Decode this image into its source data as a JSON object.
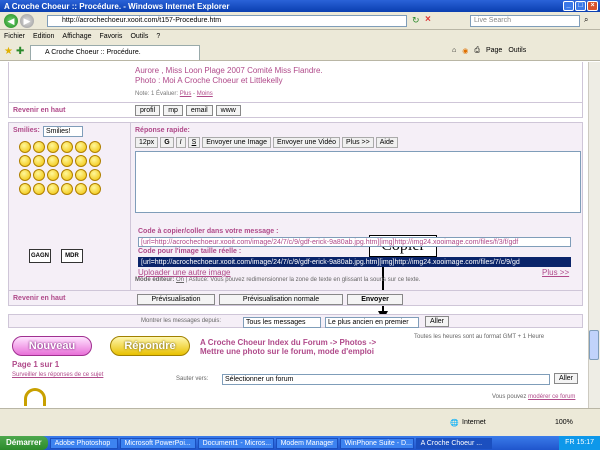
{
  "window": {
    "title": "A Croche Choeur :: Procédure. - Windows Internet Explorer"
  },
  "address": {
    "url": "http://acrochechoeur.xooit.com/t157-Procedure.htm",
    "search_placeholder": "Live Search"
  },
  "menu": [
    "Fichier",
    "Edition",
    "Affichage",
    "Favoris",
    "Outils",
    "?"
  ],
  "tab": {
    "title": "A Croche Choeur :: Procédure."
  },
  "toolbar_right": {
    "page": "Page",
    "tools": "Outils"
  },
  "post": {
    "line1": "Aurore , Miss Loon Plage 2007 Comité Miss Flandre.",
    "line2": "Photo : Moi A Croche Choeur et Littlekelly",
    "note_label": "Note:",
    "note_value": "1",
    "evaluer": "Évaluer:",
    "plus": "Plus",
    "moins": "Moins"
  },
  "back_top": "Revenir en haut",
  "profile_buttons": [
    "profil",
    "mp",
    "email",
    "www"
  ],
  "smilies_label": "Smilies:",
  "smilies_select": "Smilies!",
  "smiley_text": [
    "GAGN",
    "MDR"
  ],
  "quick_reply": {
    "title": "Réponse rapide:",
    "font_size": "12px",
    "buttons": [
      "G",
      "I",
      "S",
      "Envoyer une Image",
      "Envoyer une Vidéo",
      "Plus >>",
      "Aide"
    ]
  },
  "annotation": "Copier",
  "editor_mode": {
    "label": "Mode éditeur:",
    "on": "On",
    "sep": "|",
    "tip": "Astuce: Vous pouvez redimensionner la zone de texte en glissant la souris sur ce texte."
  },
  "codes": {
    "copy_label": "Code à copier/coller dans votre message :",
    "copy_value": "[url=http://acrochechoeur.xooit.com/image/24/7/c/9/gdf-erick-9a80ab.jpg.htm][img]http://img24.xooimage.com/files/f/3/f/gdf",
    "full_label": "Code pour l'image taille réelle :",
    "full_value": "[url=http://acrochechoeur.xooit.com/image/24/7/c/9/gdf-erick-9a80ab.jpg.htm][img]http://img24.xooimage.com/files/7/c/9/gd",
    "upload_other": "Uploader une autre image",
    "plus": "Plus >>"
  },
  "actions": {
    "preview": "Prévisualisation",
    "preview_normal": "Prévisualisation normale",
    "send": "Envoyer"
  },
  "filter": {
    "label": "Montrer les messages depuis:",
    "option1": "Tous les messages",
    "option2": "Le plus ancien en premier",
    "go": "Aller"
  },
  "footer": {
    "btn_new": "Nouveau",
    "btn_reply": "Répondre",
    "breadcrumb_line1": "A Croche Choeur Index du Forum -> Photos ->",
    "breadcrumb_line2": "Mettre une photo sur le forum, mode d'emploi",
    "timezone": "Toutes les heures sont au format GMT + 1 Heure",
    "page": "Page 1 sur 1",
    "watch": "Surveiller les réponses de ce sujet",
    "jump_label": "Sauter vers:",
    "jump_select": "Sélectionner un forum",
    "jump_go": "Aller",
    "can_post": "Vous",
    "can_post_rest": "pouvez",
    "moderate": "modérer ce forum"
  },
  "status": {
    "zone": "Internet",
    "zoom": "100%"
  },
  "taskbar": {
    "start": "Démarrer",
    "tasks": [
      "Adobe Photoshop",
      "Microsoft PowerPoi...",
      "Document1 - Micros...",
      "Modem Manager",
      "WinPhone Suite - D...",
      "A Croche Choeur ..."
    ],
    "lang": "FR",
    "time": "15:17"
  }
}
